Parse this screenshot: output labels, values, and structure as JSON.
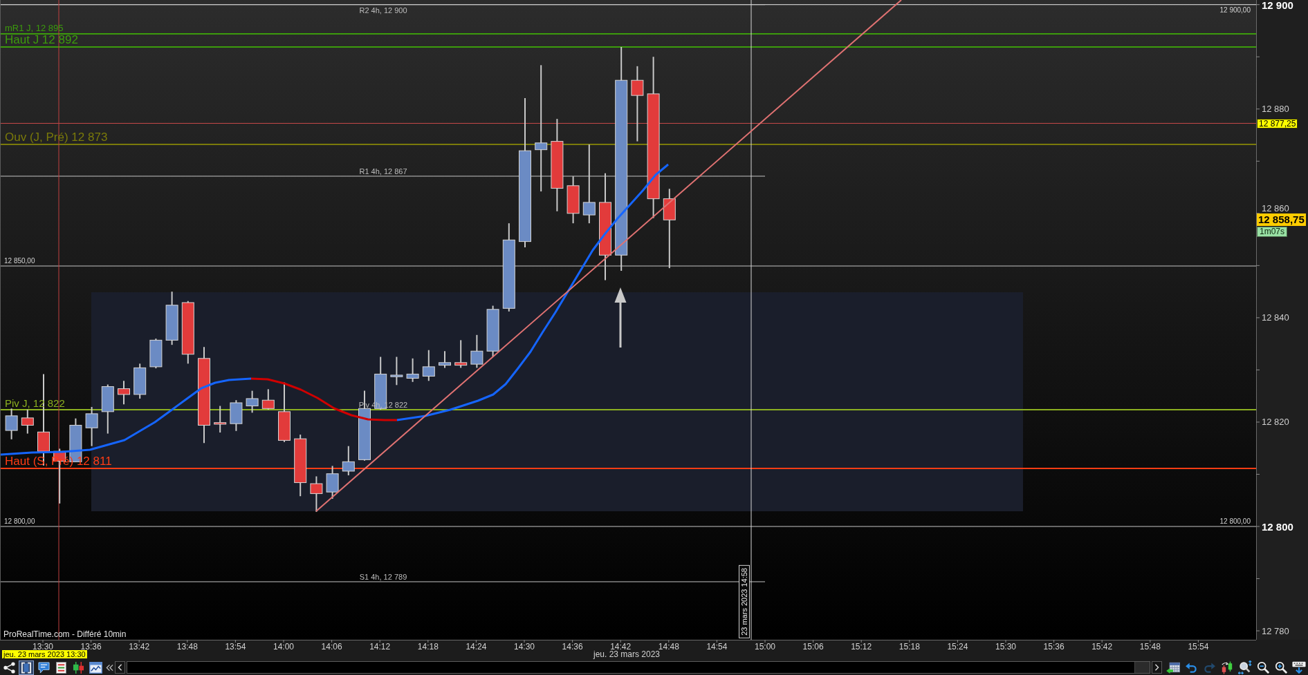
{
  "chart": {
    "round_levels": [
      {
        "right_tag": "12 900,00"
      },
      {
        "left_tag": "12 850,00"
      },
      {
        "left_tag": "12 800,00",
        "right_tag": "12 800,00"
      }
    ],
    "pivots_4h": [
      {
        "label": "R2 4h, 12 900"
      },
      {
        "label": "R1 4h, 12 867"
      },
      {
        "label": "Piv 4h, 12 822"
      },
      {
        "label": "S1 4h, 12 789"
      }
    ],
    "daily_levels": [
      {
        "kind": "minor",
        "label": "mR1 J, 12 895",
        "color": "#3c9c0c"
      },
      {
        "kind": "major",
        "label": "Haut J 12 892",
        "color": "#3c9c0c"
      },
      {
        "kind": "major",
        "label": "Ouv (J, Pré) 12 873",
        "color": "#7a7a0a"
      },
      {
        "kind": "pivot",
        "label": "Piv J, 12 822",
        "color": "#8cb020"
      },
      {
        "kind": "major",
        "label": "Haut (S, Pré) 12 811",
        "color": "#ff3c14"
      }
    ],
    "crosshair": {
      "date": "23 mars 2023 14:58"
    },
    "source_note": "ProRealTime.com - Différé 10min"
  },
  "price_axis": {
    "ticks": [
      {
        "label": "12 900",
        "major": true
      },
      {
        "label": "12 880",
        "major": false
      },
      {
        "label": "12 860",
        "major": false
      },
      {
        "label": "12 840",
        "major": false
      },
      {
        "label": "12 820",
        "major": false
      },
      {
        "label": "12 800",
        "major": true
      },
      {
        "label": "12 780",
        "major": false
      }
    ],
    "alert_price": "12 877,25",
    "last_price": "12 858,75",
    "countdown": "1m07s"
  },
  "time_axis": {
    "ticks": [
      "13:30",
      "13:36",
      "13:42",
      "13:48",
      "13:54",
      "14:00",
      "14:06",
      "14:12",
      "14:18",
      "14:24",
      "14:30",
      "14:36",
      "14:42",
      "14:48",
      "14:54",
      "15:00",
      "15:06",
      "15:12",
      "15:18",
      "15:24",
      "15:30",
      "15:36",
      "15:42",
      "15:48",
      "15:54"
    ],
    "date": "jeu. 23 mars 2023",
    "cursor_date": "jeu. 23 mars 2023 13:30"
  },
  "toolbar": {
    "left": [
      {
        "kind": "share",
        "selected": false
      },
      {
        "kind": "brackets",
        "selected": true
      },
      {
        "kind": "comment",
        "selected": false
      },
      {
        "kind": "list",
        "selected": false
      },
      {
        "kind": "candles",
        "selected": false
      },
      {
        "kind": "chart_window",
        "selected": false
      }
    ],
    "right": [
      {
        "kind": "calendar",
        "disabled": false
      },
      {
        "kind": "undo",
        "disabled": false
      },
      {
        "kind": "redo",
        "disabled": true
      },
      {
        "kind": "swap_candles",
        "disabled": false
      },
      {
        "kind": "zoom_fit",
        "disabled": false
      },
      {
        "kind": "zoom_out",
        "disabled": false
      },
      {
        "kind": "zoom_in",
        "disabled": false
      },
      {
        "kind": "keyboard",
        "disabled": false
      }
    ]
  }
}
